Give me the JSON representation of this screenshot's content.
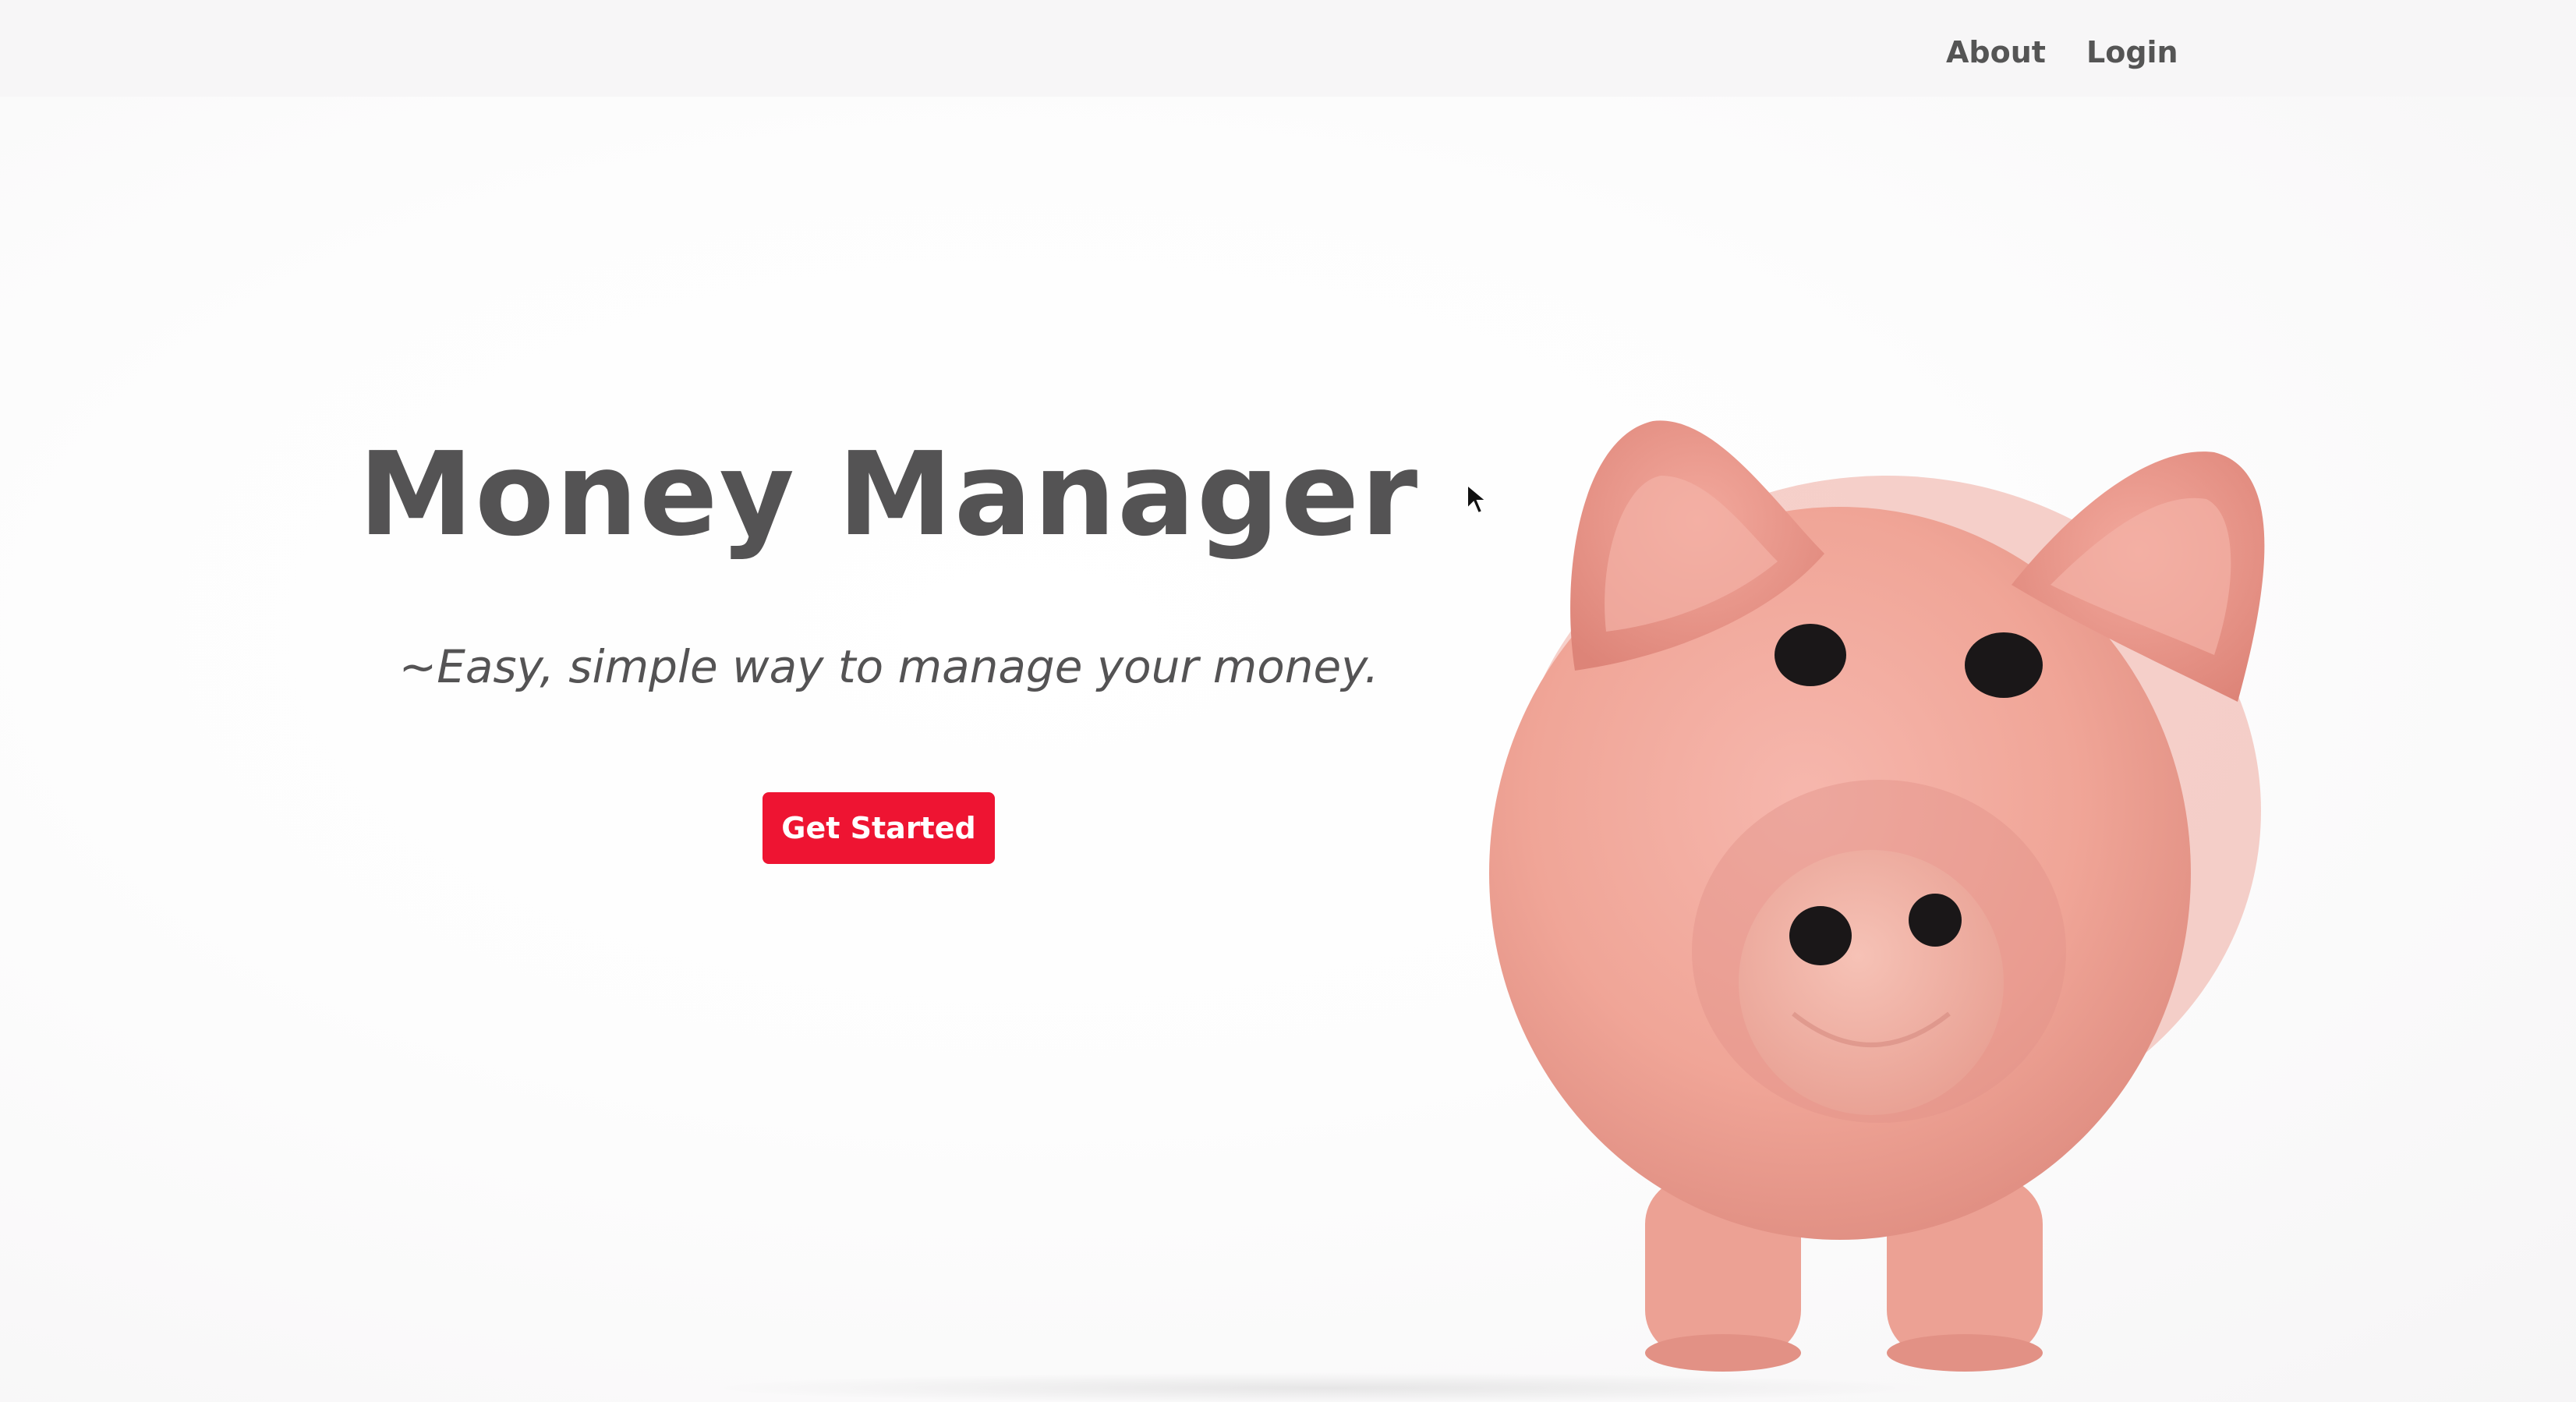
{
  "nav": {
    "about_label": "About",
    "login_label": "Login"
  },
  "hero": {
    "title": "Money Manager",
    "subtitle": "~Easy, simple way to manage your money.",
    "cta_label": "Get Started"
  },
  "colors": {
    "accent": "#ee1432",
    "text": "#545354",
    "nav_text": "#555555",
    "piggy": "#f1a79d"
  },
  "icons": {
    "cursor": "mouse-pointer-icon"
  }
}
